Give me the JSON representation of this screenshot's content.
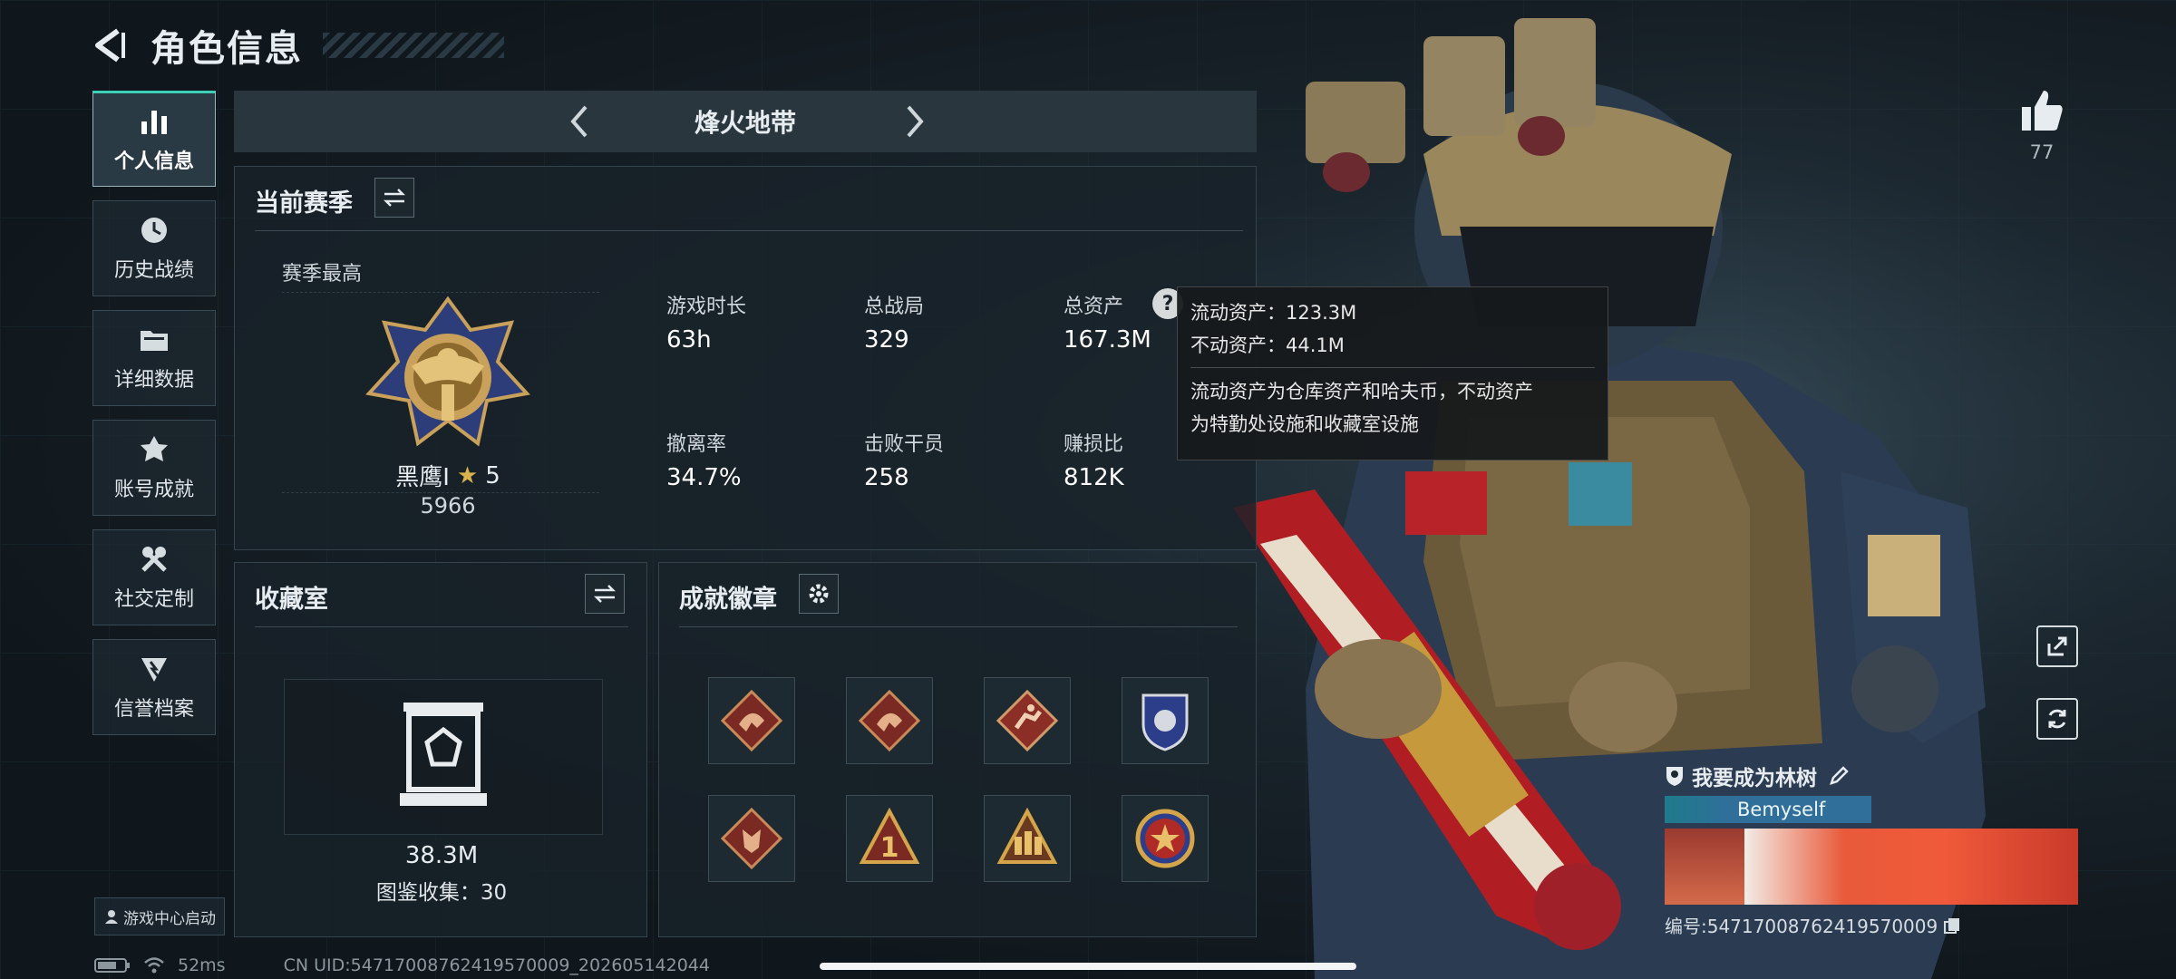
{
  "header": {
    "title": "角色信息"
  },
  "nav": {
    "items": [
      {
        "label": "个人信息"
      },
      {
        "label": "历史战绩"
      },
      {
        "label": "详细数据"
      },
      {
        "label": "账号成就"
      },
      {
        "label": "社交定制"
      },
      {
        "label": "信誉档案"
      }
    ]
  },
  "mode": {
    "title": "烽火地带"
  },
  "season": {
    "title": "当前赛季",
    "best_label": "赛季最高",
    "rank_name": "黑鹰I",
    "rank_stars": "5",
    "rank_score": "5966",
    "stats": [
      {
        "label": "游戏时长",
        "value": "63h"
      },
      {
        "label": "总战局",
        "value": "329"
      },
      {
        "label": "总资产",
        "value": "167.3M"
      },
      {
        "label": "撤离率",
        "value": "34.7%"
      },
      {
        "label": "击败干员",
        "value": "258"
      },
      {
        "label": "赚损比",
        "value": "812K"
      }
    ],
    "help_glyph": "?"
  },
  "tooltip": {
    "liquid": "流动资产：123.3M",
    "fixed": "不动资产：44.1M",
    "desc1": "流动资产为仓库资产和哈夫币，不动资产",
    "desc2": "为特勤处设施和收藏室设施"
  },
  "collection": {
    "title": "收藏室",
    "value": "38.3M",
    "catalog": "图鉴收集：30"
  },
  "achievements": {
    "title": "成就徽章",
    "badges": [
      {
        "icon": "dragon-badge-icon"
      },
      {
        "icon": "dragon-badge-icon"
      },
      {
        "icon": "runner-badge-icon"
      },
      {
        "icon": "shield-badge-icon"
      },
      {
        "icon": "wolf-badge-icon"
      },
      {
        "icon": "number-one-badge-icon",
        "text": "1"
      },
      {
        "icon": "squad-badge-icon"
      },
      {
        "icon": "star-emblem-badge-icon"
      }
    ]
  },
  "likes": {
    "count": "77"
  },
  "player": {
    "name": "我要成为林树",
    "tag": "Bemyself",
    "id_text": "编号:547170087624195700​09"
  },
  "footer": {
    "game_center": "游戏中心启动",
    "ping": "52ms",
    "uid": "CN UID:547170087624195700​09_202605142044"
  },
  "colors": {
    "accent": "#3dd0b8",
    "gold": "#c9a15a",
    "tag_bg": "#2f6f9a"
  }
}
